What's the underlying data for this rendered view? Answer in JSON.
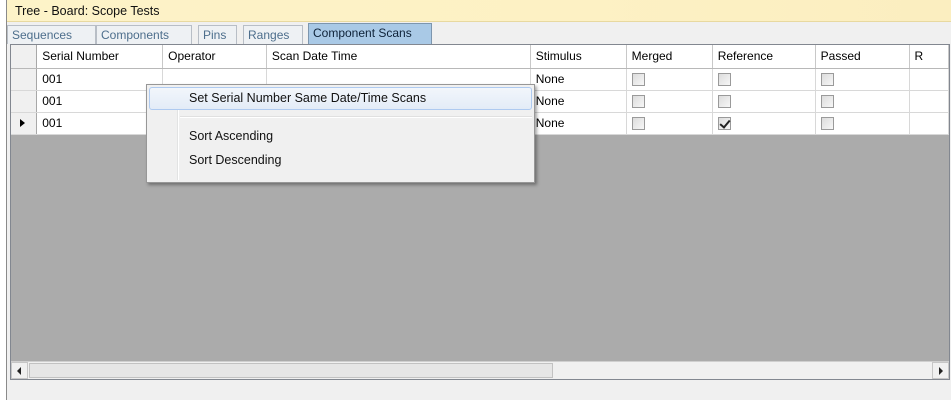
{
  "window": {
    "title": "Tree - Board: Scope Tests"
  },
  "tabs": [
    {
      "label": "Sequences",
      "active": false
    },
    {
      "label": "Components",
      "active": false
    },
    {
      "label": "Pins",
      "active": false
    },
    {
      "label": "Ranges",
      "active": false
    },
    {
      "label": "Component Scans",
      "active": true
    }
  ],
  "grid": {
    "columns": [
      "Serial Number",
      "Operator",
      "Scan Date Time",
      "Stimulus",
      "Merged",
      "Reference",
      "Passed",
      "R"
    ],
    "rows": [
      {
        "serial": "001",
        "operator": "",
        "scan_date_time": "",
        "stimulus": "None",
        "merged": false,
        "reference": false,
        "passed": false,
        "current": false
      },
      {
        "serial": "001",
        "operator": "",
        "scan_date_time": "",
        "stimulus": "None",
        "merged": false,
        "reference": false,
        "passed": false,
        "current": false
      },
      {
        "serial": "001",
        "operator": "",
        "scan_date_time": "",
        "stimulus": "None",
        "merged": false,
        "reference": true,
        "passed": false,
        "current": true
      }
    ]
  },
  "context_menu": {
    "items": [
      {
        "label": "Set Serial Number Same Date/Time Scans",
        "highlighted": true
      },
      {
        "label": "Sort Ascending",
        "highlighted": false
      },
      {
        "label": "Sort Descending",
        "highlighted": false
      }
    ]
  },
  "colors": {
    "title_bar": "#fdf1c4",
    "active_tab": "#a9c9e6",
    "grid_background": "#ababab"
  }
}
